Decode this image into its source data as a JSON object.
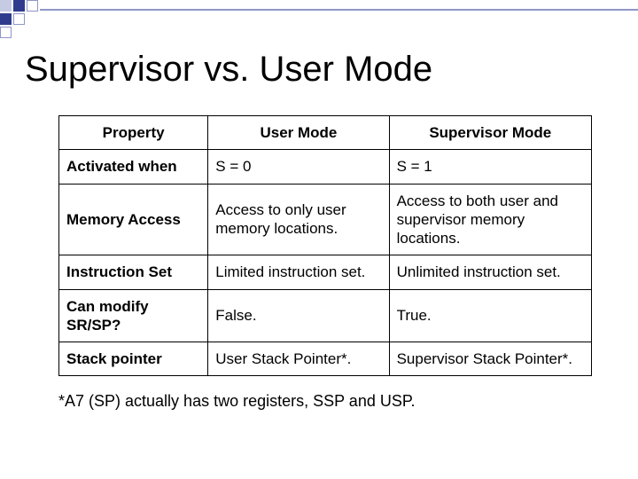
{
  "title": "Supervisor vs. User Mode",
  "chart_data": {
    "type": "table",
    "title": "Supervisor vs. User Mode",
    "columns": [
      "Property",
      "User Mode",
      "Supervisor Mode"
    ],
    "rows": [
      [
        "Activated when",
        "S = 0",
        "S = 1"
      ],
      [
        "Memory Access",
        "Access to only user memory locations.",
        "Access to both user and supervisor memory locations."
      ],
      [
        "Instruction Set",
        "Limited instruction set.",
        "Unlimited instruction set."
      ],
      [
        "Can modify SR/SP?",
        "False.",
        "True."
      ],
      [
        "Stack pointer",
        "User Stack Pointer*.",
        "Supervisor Stack Pointer*."
      ]
    ]
  },
  "footnote": "*A7 (SP) actually has two registers, SSP and USP."
}
